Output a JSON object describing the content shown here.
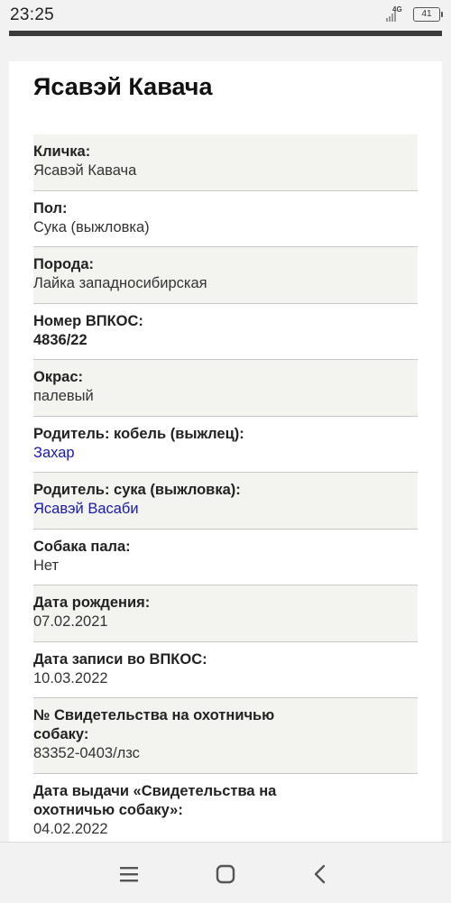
{
  "status_bar": {
    "time": "23:25",
    "network": "4G",
    "battery": "41"
  },
  "page": {
    "title": "Ясавэй Кавача"
  },
  "fields": [
    {
      "label": "Кличка:",
      "value": "Ясавэй Кавача"
    },
    {
      "label": "Пол:",
      "value": "Сука (выжловка)"
    },
    {
      "label": "Порода:",
      "value": "Лайка западносибирская"
    },
    {
      "label": "Номер ВПКОС:",
      "value": "4836/22"
    },
    {
      "label": "Окрас:",
      "value": "палевый"
    },
    {
      "label": "Родитель: кобель (выжлец):",
      "value": "Захар"
    },
    {
      "label": "Родитель: сука (выжловка):",
      "value": "Ясавэй Васаби"
    },
    {
      "label": "Собака пала:",
      "value": "Нет"
    },
    {
      "label": "Дата рождения:",
      "value": "07.02.2021"
    },
    {
      "label": "Дата записи во ВПКОС:",
      "value": "10.03.2022"
    },
    {
      "label": "№ Свидетельства на охотничью собаку:",
      "value": "83352-0403/лзс"
    },
    {
      "label": "Дата выдачи «Свидетельства на охотничью собаку»:",
      "value": "04.02.2022"
    }
  ],
  "colors": {
    "link": "#1a1aa8",
    "row_shade": "#f3f3ef",
    "divider": "#c8c8c8"
  },
  "nav": {
    "icons": [
      "menu-icon",
      "home-icon",
      "back-icon"
    ]
  }
}
